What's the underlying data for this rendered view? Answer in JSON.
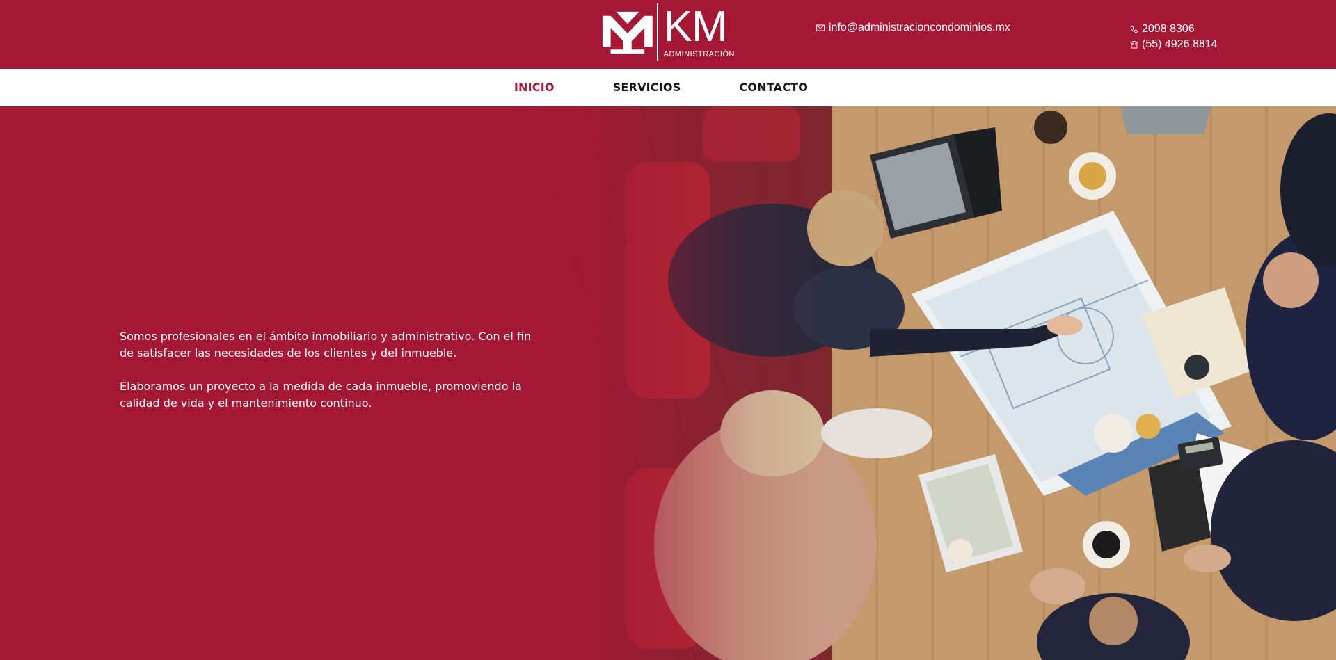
{
  "header": {
    "logo": {
      "brand": "KM",
      "subtitle": "ADMINISTRACIÓN"
    },
    "email": "info@administracioncondominios.mx",
    "phones": [
      "2098 8306",
      "(55) 4926 8814"
    ],
    "icons": {
      "email": "envelope-icon",
      "phone": "phone-icon",
      "mobile": "telephone-icon"
    }
  },
  "nav": {
    "items": [
      {
        "label": "INICIO",
        "active": true
      },
      {
        "label": "SERVICIOS",
        "active": false
      },
      {
        "label": "CONTACTO",
        "active": false
      }
    ]
  },
  "hero": {
    "paragraphs": [
      "Somos profesionales en el ámbito inmobiliario y administrativo. Con el fin de satisfacer las necesidades de los clientes y del inmueble.",
      "Elaboramos un proyecto a la medida de cada inmueble, promoviendo la calidad de vida y el mantenimiento continuo."
    ],
    "image_alt": "Reunión de trabajo vista desde arriba"
  },
  "colors": {
    "brand": "#a51835",
    "nav_text": "#151515",
    "nav_active": "#a51835",
    "white": "#ffffff"
  }
}
